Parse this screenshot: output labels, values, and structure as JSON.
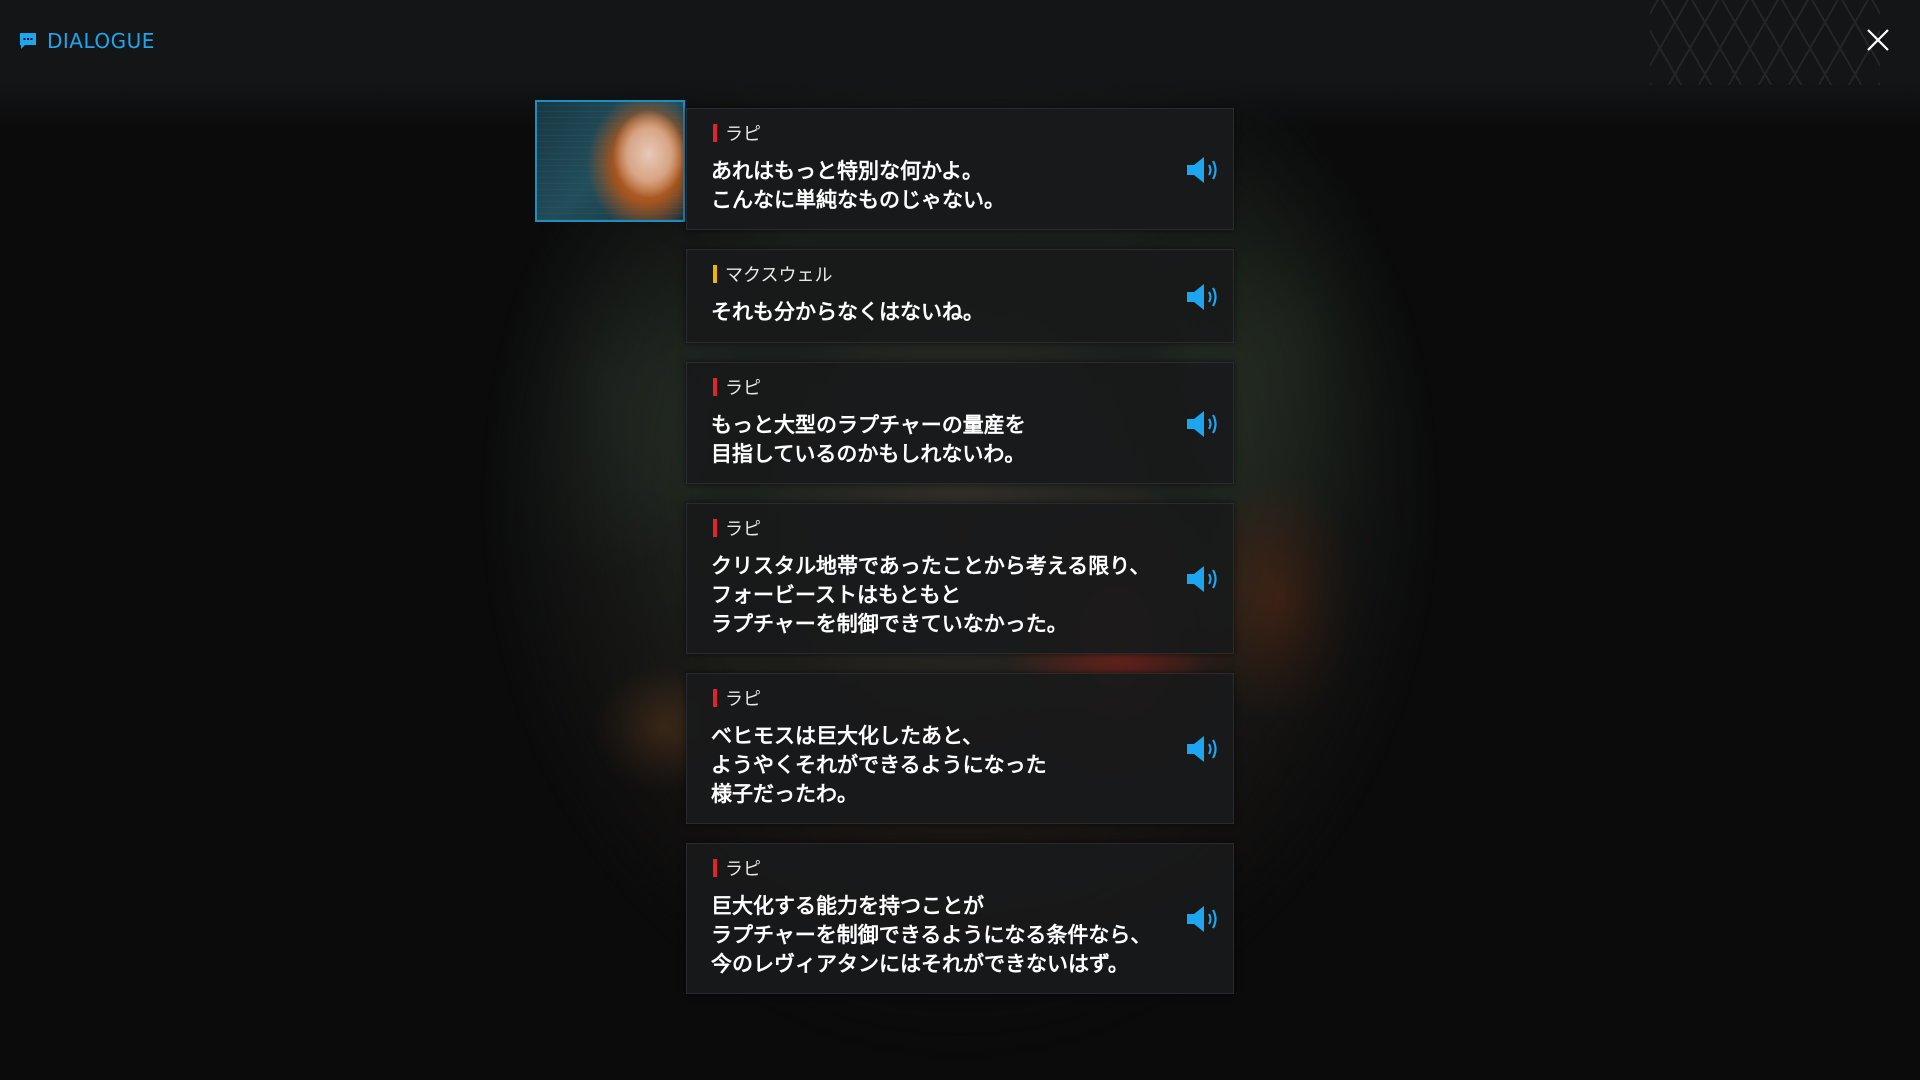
{
  "header": {
    "title": "DIALOGUE",
    "icon": "chat-bubble-icon",
    "close_icon": "close-icon"
  },
  "colors": {
    "accent": "#1ea5f0",
    "speaker_red": "#e0252a",
    "speaker_yellow": "#f0b400",
    "panel": "#18191b"
  },
  "entries": [
    {
      "speaker": "ラピ",
      "speaker_color": "#e0252a",
      "text": "あれはもっと特別な何かよ。\nこんなに単純なものじゃない。",
      "voice_icon": "speaker-icon"
    },
    {
      "speaker": "マクスウェル",
      "speaker_color": "#f0b400",
      "text": "それも分からなくはないね。",
      "voice_icon": "speaker-icon"
    },
    {
      "speaker": "ラピ",
      "speaker_color": "#e0252a",
      "text": "もっと大型のラプチャーの量産を\n目指しているのかもしれないわ。",
      "voice_icon": "speaker-icon"
    },
    {
      "speaker": "ラピ",
      "speaker_color": "#e0252a",
      "text": "クリスタル地帯であったことから考える限り、\nフォービーストはもともと\nラプチャーを制御できていなかった。",
      "voice_icon": "speaker-icon"
    },
    {
      "speaker": "ラピ",
      "speaker_color": "#e0252a",
      "text": "ベヒモスは巨大化したあと、\nようやくそれができるようになった\n様子だったわ。",
      "voice_icon": "speaker-icon"
    },
    {
      "speaker": "ラピ",
      "speaker_color": "#e0252a",
      "text": "巨大化する能力を持つことが\nラプチャーを制御できるようになる条件なら、\n今のレヴィアタンにはそれができないはず。",
      "voice_icon": "speaker-icon"
    }
  ]
}
